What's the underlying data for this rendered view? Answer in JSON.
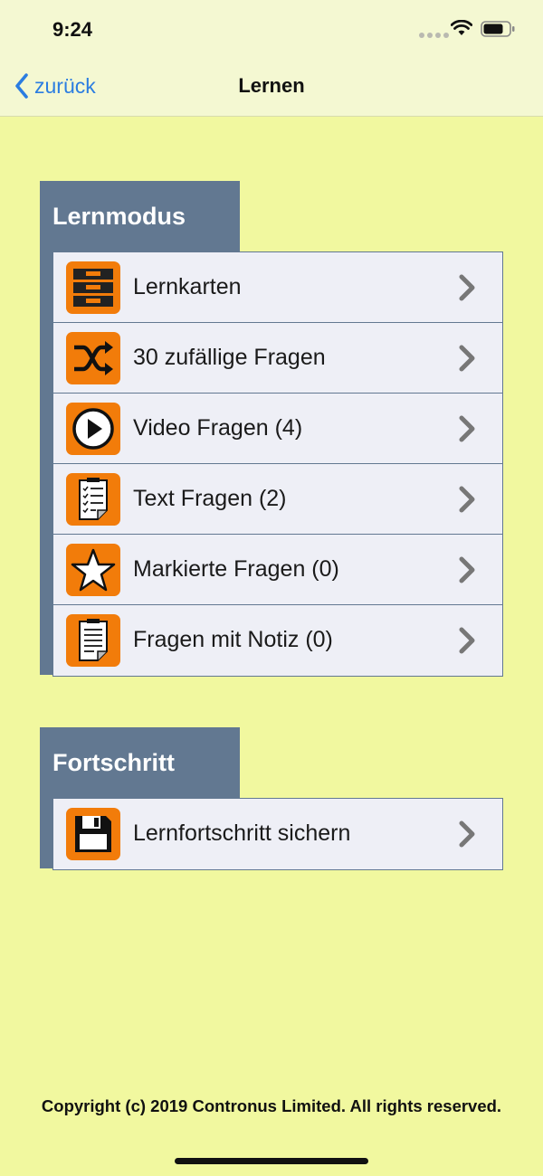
{
  "status_bar": {
    "time": "9:24"
  },
  "nav": {
    "back_label": "zurück",
    "title": "Lernen"
  },
  "sections": [
    {
      "title": "Lernmodus",
      "items": [
        {
          "label": "Lernkarten",
          "icon": "drawers-icon"
        },
        {
          "label": "30 zufällige Fragen",
          "icon": "shuffle-icon"
        },
        {
          "label": "Video Fragen (4)",
          "icon": "play-icon"
        },
        {
          "label": "Text Fragen (2)",
          "icon": "checklist-icon"
        },
        {
          "label": "Markierte Fragen (0)",
          "icon": "star-icon"
        },
        {
          "label": "Fragen mit Notiz (0)",
          "icon": "note-icon"
        }
      ]
    },
    {
      "title": "Fortschritt",
      "items": [
        {
          "label": "Lernfortschritt sichern",
          "icon": "floppy-disk-icon"
        }
      ]
    }
  ],
  "footer": {
    "copyright": "Copyright (c) 2019 Contronus Limited. All rights reserved."
  },
  "colors": {
    "background": "#f1f89f",
    "section_header": "#627891",
    "icon_bg": "#f27c0a",
    "row_bg": "#eeeff6",
    "link": "#2b7de1"
  }
}
